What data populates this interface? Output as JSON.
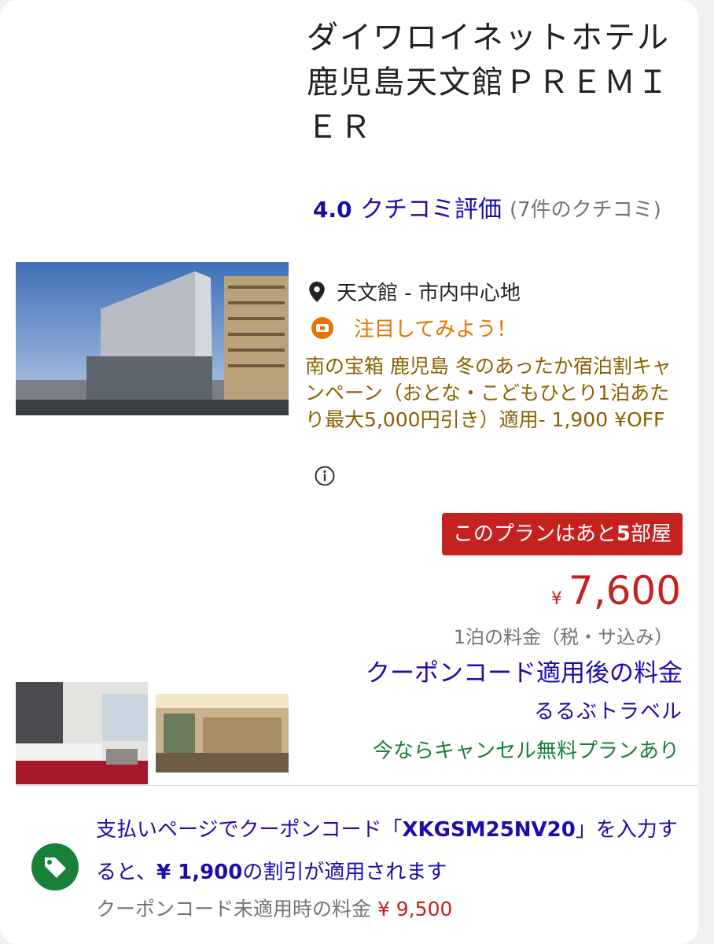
{
  "hotel": {
    "name": "ダイワロイネットホテル鹿児島天文館ＰＲＥＭＩＥＲ",
    "rating_score": "4.0",
    "rating_label": "クチコミ評価",
    "review_count": "(7件のクチコミ)",
    "location": "天文館 - 市内中心地",
    "promo_label": "注目してみよう！",
    "deal_text": "南の宝箱 鹿児島 冬のあったか宿泊割キャンペーン（おとな・こどもひとり1泊あたり最大5,000円引き）適用- 1,900 ¥OFF"
  },
  "booking": {
    "rooms_left_prefix": "このプランはあと",
    "rooms_left_count": "5",
    "rooms_left_suffix": "部屋",
    "price_currency": "¥",
    "price": "7,600",
    "price_note": "1泊の料金（税・サ込み）",
    "coupon_price_label": "クーポンコード適用後の料金",
    "provider": "るるぶトラベル",
    "cancellation": "今ならキャンセル無料プランあり"
  },
  "coupon": {
    "text_1": "支払いページでクーポンコード「",
    "code": "XKGSM25NV20",
    "text_2": "」を入力すると、",
    "discount": "¥ 1,900",
    "text_3": "の割引が適用されます",
    "original_label": "クーポンコード未適用時の料金 ",
    "original_price": "¥ 9,500"
  },
  "icons": {
    "location": "map-pin-icon",
    "promo": "ticket-icon",
    "info": "info-icon",
    "coupon": "tag-icon"
  },
  "colors": {
    "link_blue": "#1a0dab",
    "price_red": "#c5221f",
    "promo_orange": "#e37400",
    "deal_brown": "#8a6100",
    "cancel_green": "#188038",
    "tag_green": "#188038"
  }
}
